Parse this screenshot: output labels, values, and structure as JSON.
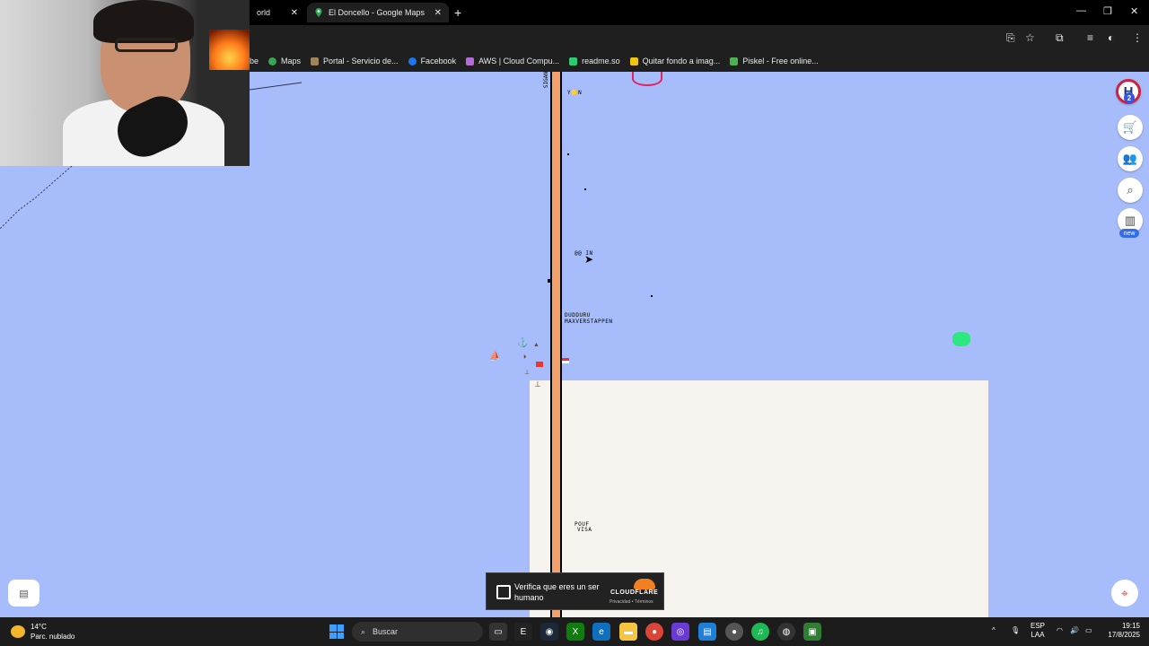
{
  "browser": {
    "tabs": [
      {
        "label": "orld",
        "active": false
      },
      {
        "label": "El Doncello - Google Maps",
        "active": true
      }
    ],
    "bookmarks": [
      {
        "label": "be",
        "icon": "bookmark-icon"
      },
      {
        "label": "Maps",
        "icon": "maps-pin-icon"
      },
      {
        "label": "Portal - Servicio de...",
        "icon": "portal-icon"
      },
      {
        "label": "Facebook",
        "icon": "facebook-icon"
      },
      {
        "label": "AWS | Cloud Compu...",
        "icon": "aws-icon"
      },
      {
        "label": "readme.so",
        "icon": "readme-icon"
      },
      {
        "label": "Quitar fondo a imag...",
        "icon": "image-icon"
      },
      {
        "label": "Piskel - Free online...",
        "icon": "piskel-icon"
      }
    ]
  },
  "canvas": {
    "label_top": "Y🟡N",
    "label_mid": "@@ IN",
    "label_player1": "DUDDURU",
    "label_player2": "MAXVERSTAPPEN",
    "label_bottom1": "POUF",
    "label_bottom2": "VISA",
    "vertical_label": "SIGAN"
  },
  "rail": {
    "badge_count": "2",
    "new_label": "new"
  },
  "cloudflare": {
    "prompt": "Verifica que eres un ser humano",
    "brand": "CLOUDFLARE",
    "links": "Privacidad • Términos"
  },
  "taskbar": {
    "temp": "14°C",
    "weather": "Parc. nublado",
    "search_placeholder": "Buscar",
    "lang1": "ESP",
    "lang2": "LAA",
    "time": "19:15",
    "date": "17/8/2025"
  },
  "colors": {
    "map_water": "#a7bdfb",
    "road": "#f4a06a",
    "land": "#f7f4ef",
    "accent_green": "#2ee87f"
  }
}
